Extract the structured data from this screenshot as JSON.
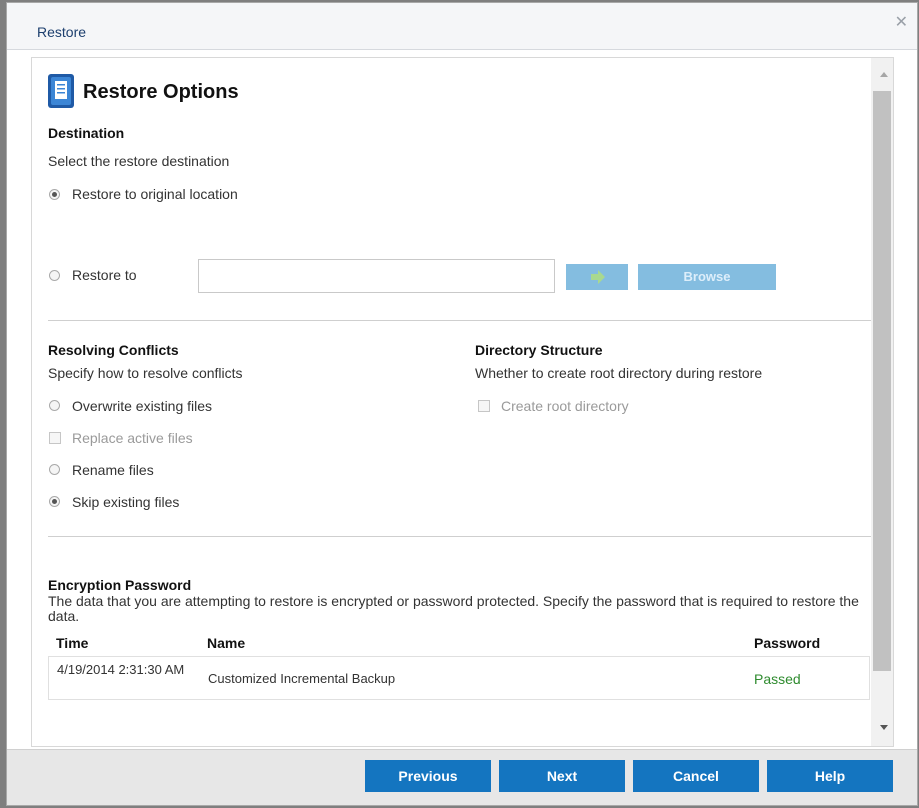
{
  "dialog": {
    "title": "Restore",
    "close_icon": "close-icon"
  },
  "page": {
    "heading": "Restore Options",
    "heading_icon": "document-icon"
  },
  "destination": {
    "heading": "Destination",
    "description": "Select the restore destination",
    "option_original": "Restore to original location",
    "option_restore_to": "Restore to",
    "path_value": "",
    "go_icon": "arrow-right-icon",
    "browse_label": "Browse",
    "selected": "original"
  },
  "conflicts": {
    "heading": "Resolving Conflicts",
    "description": "Specify how to resolve conflicts",
    "overwrite": "Overwrite existing files",
    "replace_active": "Replace active files",
    "rename": "Rename files",
    "skip": "Skip existing files",
    "selected": "skip"
  },
  "directory": {
    "heading": "Directory Structure",
    "description": "Whether to create root directory during restore",
    "create_root": "Create root directory"
  },
  "encryption": {
    "heading": "Encryption Password",
    "description": "The data that you are attempting to restore is encrypted or password protected. Specify the password that is required to restore the data.",
    "columns": {
      "time": "Time",
      "name": "Name",
      "password": "Password"
    },
    "rows": [
      {
        "time": "4/19/2014 2:31:30 AM",
        "name": "Customized Incremental Backup",
        "password": "Passed"
      }
    ],
    "passed_color": "#2e8b2e"
  },
  "footer": {
    "previous": "Previous",
    "next": "Next",
    "cancel": "Cancel",
    "help": "Help"
  },
  "colors": {
    "primary_button": "#1475c0",
    "disabled_button": "#84bde0",
    "title_text": "#1d3f6e"
  }
}
